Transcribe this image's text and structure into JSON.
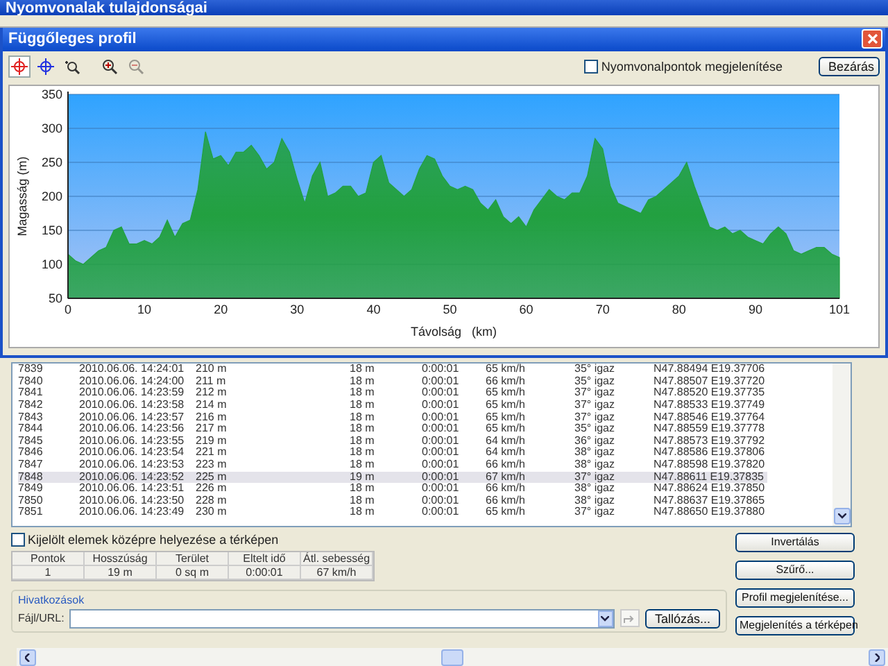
{
  "window": {
    "title": "Nyomvonalak tulajdonságai"
  },
  "dialog": {
    "title": "Függőleges profil",
    "tools": [
      {
        "kind": "target",
        "selected": true,
        "disabled": false
      },
      {
        "kind": "crosshair",
        "selected": false,
        "disabled": false
      },
      {
        "kind": "zoom-area",
        "selected": false,
        "disabled": false
      },
      {
        "kind": "zoom-in",
        "selected": false,
        "disabled": false
      },
      {
        "kind": "zoom-out",
        "selected": false,
        "disabled": true
      }
    ],
    "show_points": {
      "label": "Nyomvonalpontok megjelenítése",
      "checked": false
    },
    "close_button": "Bezárás",
    "chart_data": {
      "type": "area",
      "grid": true,
      "xlabel": "Távolság   (km)",
      "ylabel": "Magasság (m)",
      "xlim": [
        0,
        101
      ],
      "ylim": [
        50,
        350
      ],
      "xticks": [
        0,
        10,
        20,
        30,
        40,
        50,
        60,
        70,
        80,
        90,
        101
      ],
      "yticks": [
        50,
        100,
        150,
        200,
        250,
        300,
        350
      ],
      "x": [
        0,
        1,
        2,
        3,
        4,
        5,
        6,
        7,
        8,
        9,
        10,
        11,
        12,
        13,
        14,
        15,
        16,
        17,
        18,
        19,
        20,
        21,
        22,
        23,
        24,
        25,
        26,
        27,
        28,
        29,
        30,
        31,
        32,
        33,
        34,
        35,
        36,
        37,
        38,
        39,
        40,
        41,
        42,
        43,
        44,
        45,
        46,
        47,
        48,
        49,
        50,
        51,
        52,
        53,
        54,
        55,
        56,
        57,
        58,
        59,
        60,
        61,
        62,
        63,
        64,
        65,
        66,
        67,
        68,
        69,
        70,
        71,
        72,
        73,
        74,
        75,
        76,
        77,
        78,
        79,
        80,
        81,
        82,
        83,
        84,
        85,
        86,
        87,
        88,
        89,
        90,
        91,
        92,
        93,
        94,
        95,
        96,
        97,
        98,
        99,
        100,
        101
      ],
      "series": [
        {
          "color": "#22a040",
          "values": [
            115,
            105,
            100,
            110,
            120,
            125,
            150,
            155,
            130,
            130,
            135,
            130,
            140,
            165,
            140,
            160,
            165,
            210,
            295,
            255,
            260,
            245,
            265,
            265,
            275,
            260,
            240,
            250,
            285,
            265,
            225,
            190,
            230,
            250,
            200,
            205,
            215,
            215,
            200,
            205,
            250,
            260,
            220,
            210,
            200,
            210,
            240,
            260,
            255,
            230,
            215,
            210,
            215,
            210,
            190,
            180,
            195,
            170,
            160,
            170,
            155,
            180,
            195,
            210,
            200,
            195,
            205,
            205,
            230,
            285,
            270,
            215,
            190,
            185,
            180,
            175,
            195,
            200,
            210,
            220,
            230,
            250,
            215,
            185,
            155,
            150,
            155,
            145,
            150,
            140,
            135,
            130,
            145,
            155,
            145,
            120,
            115,
            120,
            125,
            125,
            115,
            110
          ]
        }
      ]
    }
  },
  "points_table": {
    "rows": [
      {
        "cells": [
          "7839",
          "2010.06.06. 14:24:01",
          "210 m",
          "18 m",
          "0:00:01",
          "65 km/h",
          "35° igaz",
          "N47.88494 E19.37706"
        ],
        "selected": false
      },
      {
        "cells": [
          "7840",
          "2010.06.06. 14:24:00",
          "211 m",
          "18 m",
          "0:00:01",
          "66 km/h",
          "35° igaz",
          "N47.88507 E19.37720"
        ],
        "selected": false
      },
      {
        "cells": [
          "7841",
          "2010.06.06. 14:23:59",
          "212 m",
          "18 m",
          "0:00:01",
          "65 km/h",
          "37° igaz",
          "N47.88520 E19.37735"
        ],
        "selected": false
      },
      {
        "cells": [
          "7842",
          "2010.06.06. 14:23:58",
          "214 m",
          "18 m",
          "0:00:01",
          "65 km/h",
          "37° igaz",
          "N47.88533 E19.37749"
        ],
        "selected": false
      },
      {
        "cells": [
          "7843",
          "2010.06.06. 14:23:57",
          "216 m",
          "18 m",
          "0:00:01",
          "65 km/h",
          "37° igaz",
          "N47.88546 E19.37764"
        ],
        "selected": false
      },
      {
        "cells": [
          "7844",
          "2010.06.06. 14:23:56",
          "217 m",
          "18 m",
          "0:00:01",
          "65 km/h",
          "35° igaz",
          "N47.88559 E19.37778"
        ],
        "selected": false
      },
      {
        "cells": [
          "7845",
          "2010.06.06. 14:23:55",
          "219 m",
          "18 m",
          "0:00:01",
          "64 km/h",
          "36° igaz",
          "N47.88573 E19.37792"
        ],
        "selected": false
      },
      {
        "cells": [
          "7846",
          "2010.06.06. 14:23:54",
          "221 m",
          "18 m",
          "0:00:01",
          "64 km/h",
          "38° igaz",
          "N47.88586 E19.37806"
        ],
        "selected": false
      },
      {
        "cells": [
          "7847",
          "2010.06.06. 14:23:53",
          "223 m",
          "18 m",
          "0:00:01",
          "66 km/h",
          "38° igaz",
          "N47.88598 E19.37820"
        ],
        "selected": false
      },
      {
        "cells": [
          "7848",
          "2010.06.06. 14:23:52",
          "225 m",
          "19 m",
          "0:00:01",
          "67 km/h",
          "37° igaz",
          "N47.88611 E19.37835"
        ],
        "selected": true
      },
      {
        "cells": [
          "7849",
          "2010.06.06. 14:23:51",
          "226 m",
          "18 m",
          "0:00:01",
          "66 km/h",
          "38° igaz",
          "N47.88624 E19.37850"
        ],
        "selected": false
      },
      {
        "cells": [
          "7850",
          "2010.06.06. 14:23:50",
          "228 m",
          "18 m",
          "0:00:01",
          "66 km/h",
          "38° igaz",
          "N47.88637 E19.37865"
        ],
        "selected": false
      },
      {
        "cells": [
          "7851",
          "2010.06.06. 14:23:49",
          "230 m",
          "18 m",
          "0:00:01",
          "65 km/h",
          "37° igaz",
          "N47.88650 E19.37880"
        ],
        "selected": false
      }
    ]
  },
  "center_option": {
    "label": "Kijelölt elemek középre helyezése a térképen",
    "checked": false
  },
  "summary": {
    "columns": [
      "Pontok",
      "Hosszúság",
      "Terület",
      "Eltelt idő",
      "Átl. sebesség"
    ],
    "values": [
      "1",
      "19 m",
      "0 sq m",
      "0:00:01",
      "67 km/h"
    ]
  },
  "links": {
    "title": "Hivatkozások",
    "field_label": "Fájl/URL:",
    "browse_button": "Tallózás..."
  },
  "actions": [
    "Invertálás",
    "Szűrő...",
    "Profil megjelenítése...",
    "Megjelenítés a térképen"
  ]
}
